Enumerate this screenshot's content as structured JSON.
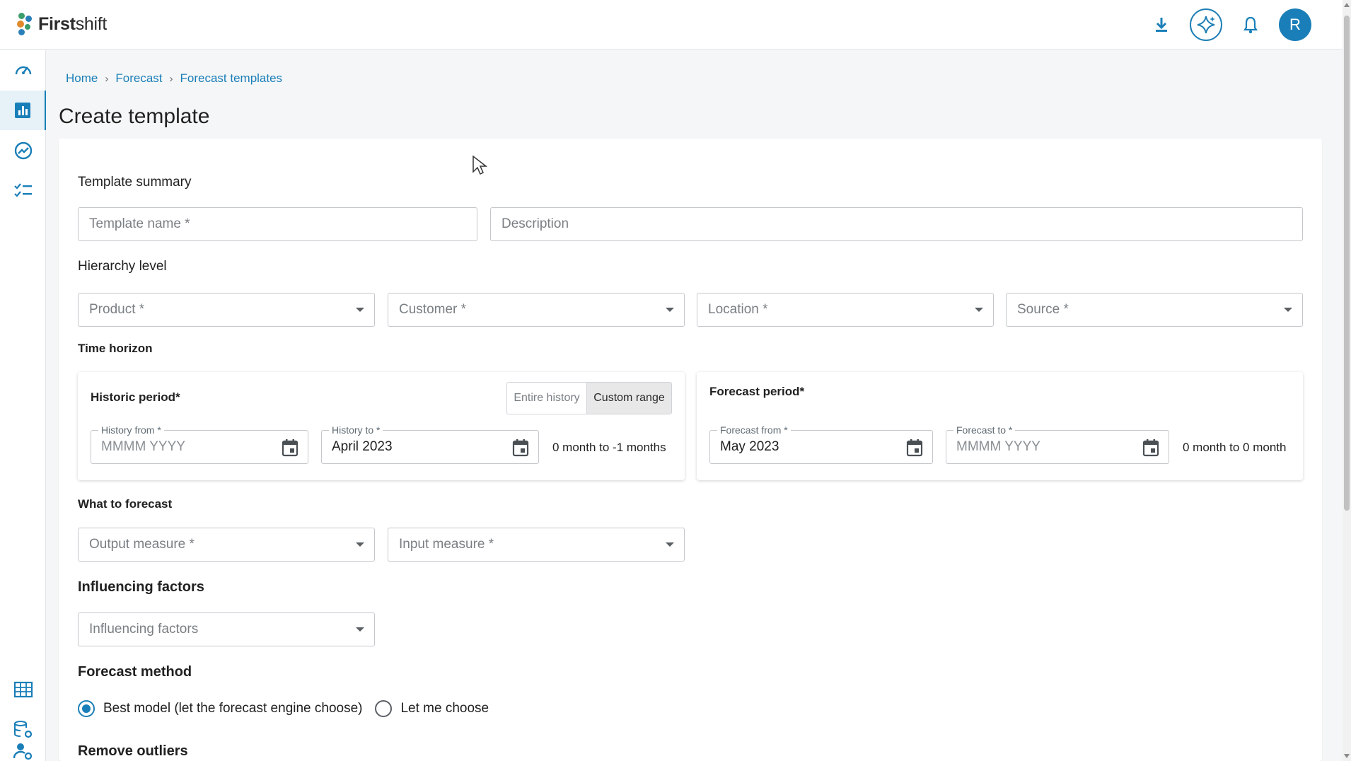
{
  "brand": {
    "name_bold": "First",
    "name_light": "shift"
  },
  "topbar": {
    "avatar_initial": "R"
  },
  "breadcrumb": [
    "Home",
    "Forecast",
    "Forecast templates"
  ],
  "page_title": "Create template",
  "template_summary": {
    "label": "Template summary",
    "name_placeholder": "Template name *",
    "description_placeholder": "Description"
  },
  "hierarchy": {
    "label": "Hierarchy level",
    "fields": [
      "Product *",
      "Customer *",
      "Location *",
      "Source *"
    ]
  },
  "time_horizon": {
    "label": "Time horizon",
    "historic": {
      "title": "Historic period*",
      "toggle": [
        "Entire history",
        "Custom range"
      ],
      "selected_toggle": "Custom range",
      "from_label": "History from *",
      "from_value": "",
      "from_placeholder": "MMMM YYYY",
      "to_label": "History to *",
      "to_value": "April 2023",
      "range_text": "0 month to -1 months"
    },
    "forecast": {
      "title": "Forecast period*",
      "from_label": "Forecast from *",
      "from_value": "May 2023",
      "to_label": "Forecast to *",
      "to_value": "",
      "to_placeholder": "MMMM YYYY",
      "range_text": "0 month to 0 month"
    }
  },
  "what_to_forecast": {
    "label": "What to forecast",
    "fields": [
      "Output measure *",
      "Input measure *"
    ]
  },
  "influencing_factors": {
    "label": "Influencing factors",
    "placeholder": "Influencing factors"
  },
  "forecast_method": {
    "label": "Forecast method",
    "options": [
      "Best model (let the forecast engine choose)",
      "Let me choose"
    ],
    "selected": 0
  },
  "remove_outliers": {
    "label": "Remove outliers"
  },
  "colors": {
    "accent": "#1a7fb8",
    "border": "#c4c8cc"
  }
}
